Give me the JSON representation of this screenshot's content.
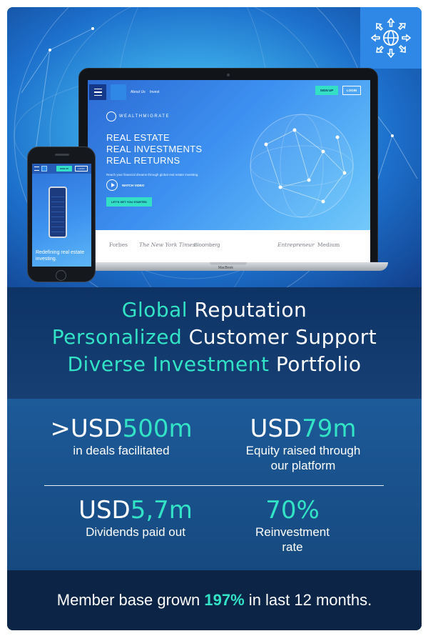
{
  "hero": {
    "site": {
      "nav_links": [
        "About Us",
        "Invest"
      ],
      "signup": "SIGN UP",
      "login": "LOGIN",
      "brand": "WEALTHMIGRATE",
      "headline": [
        "REAL ESTATE",
        "REAL INVESTMENTS",
        "REAL RETURNS"
      ],
      "subtext": "Reach your financial dreams through global real estate investing.",
      "watch_video": "WATCH VIDEO",
      "start_button": "LET'S GET YOU STARTED",
      "press": [
        "Forbes",
        "The New York Times",
        "Bloomberg",
        "Entrepreneur",
        "Medium"
      ]
    },
    "laptop_model": "MacBook",
    "phone": {
      "signup": "SIGN UP",
      "login": "LOGIN",
      "caption": "Redefining real estate investing."
    }
  },
  "tagline": [
    {
      "highlight": "Global",
      "rest": " Reputation"
    },
    {
      "highlight": "Personalized",
      "rest": " Customer Support"
    },
    {
      "highlight": "Diverse Investment",
      "rest": " Portfolio"
    }
  ],
  "stats": [
    {
      "prefix": ">USD",
      "value": "500m",
      "label": "in deals facilitated"
    },
    {
      "prefix": "USD",
      "value": "79m",
      "label_line1": "Equity raised through",
      "label_line2": "our platform"
    },
    {
      "prefix": "USD",
      "value": "5,7m",
      "label": "Dividends paid out"
    },
    {
      "prefix": "",
      "value": "70%",
      "label_line1": "Reinvestment",
      "label_line2": "rate"
    }
  ],
  "footer": {
    "before": "Member base grown ",
    "highlight": "197%",
    "after": " in last 12 months."
  },
  "colors": {
    "accent_teal": "#33e3c6",
    "navy": "#0c2547",
    "stats_blue": "#1d5a99",
    "hero_blue": "#39a6e6"
  }
}
